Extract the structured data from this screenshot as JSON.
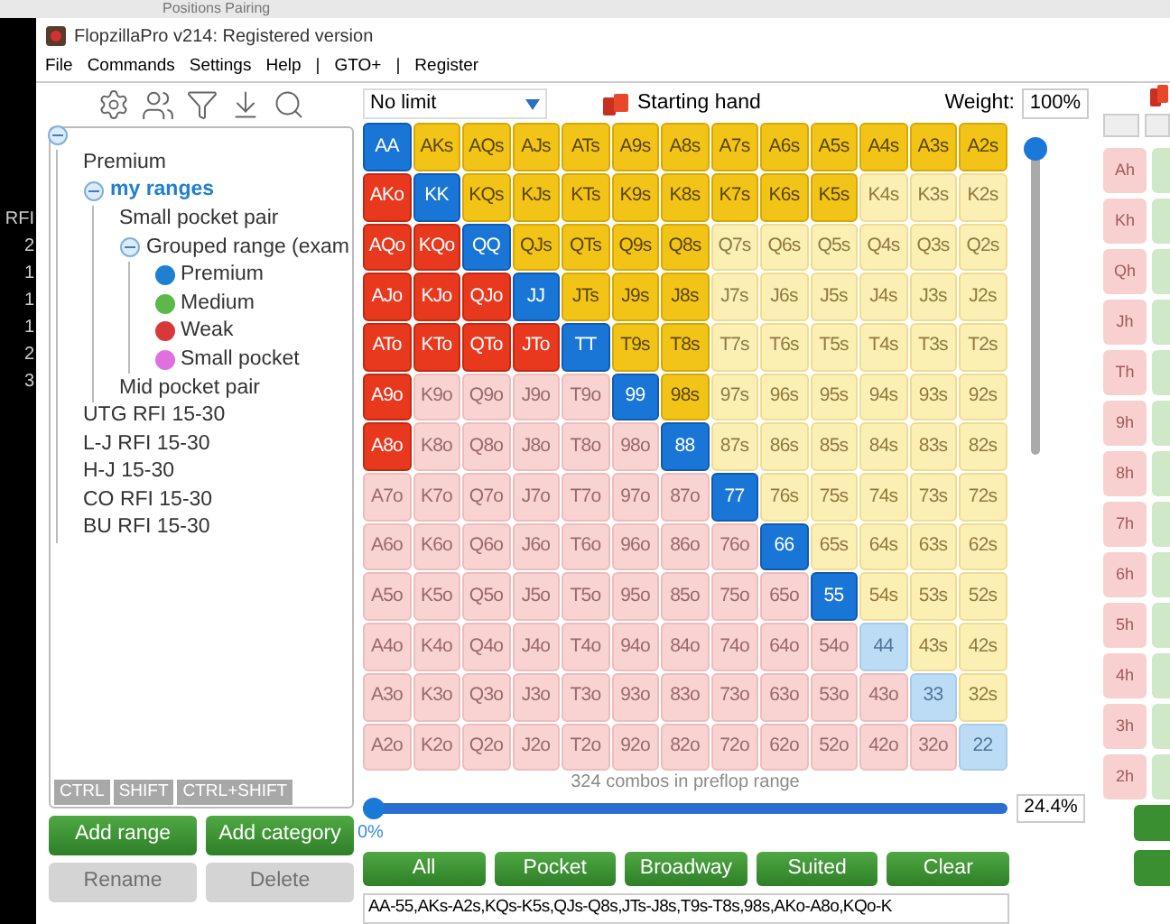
{
  "background_window": {
    "title": "Positions Pairing",
    "column_header": "RFI",
    "values": [
      "2",
      "1",
      "1",
      "1",
      "2",
      "3"
    ]
  },
  "window": {
    "title": "FlopzillaPro v214: Registered version"
  },
  "menu": [
    "File",
    "Commands",
    "Settings",
    "Help",
    "|",
    "GTO+",
    "|",
    "Register"
  ],
  "tree": {
    "expanded": true,
    "children": [
      {
        "label": "Premium",
        "selected": false
      },
      {
        "label": "my ranges",
        "selected": true,
        "expanded": true,
        "children": [
          {
            "label": "Small pocket pair",
            "selected": false
          },
          {
            "label": "Grouped range (exam",
            "selected": false,
            "expanded": true,
            "children": [
              {
                "label": "Premium",
                "selected": false,
                "color": "#1f7fd0"
              },
              {
                "label": "Medium",
                "selected": false,
                "color": "#5cb84a"
              },
              {
                "label": "Weak",
                "selected": false,
                "color": "#d8383a"
              },
              {
                "label": "Small pocket",
                "selected": false,
                "color": "#e070e0"
              }
            ]
          },
          {
            "label": "Mid pocket pair",
            "selected": false
          }
        ]
      },
      {
        "label": "UTG RFI 15-30",
        "selected": false
      },
      {
        "label": "L-J RFI 15-30",
        "selected": false
      },
      {
        "label": "H-J 15-30",
        "selected": false
      },
      {
        "label": "CO RFI 15-30",
        "selected": false
      },
      {
        "label": "BU RFI 15-30",
        "selected": false
      }
    ]
  },
  "modifier_keys": [
    "CTRL",
    "SHIFT",
    "CTRL+SHIFT"
  ],
  "left_buttons": [
    {
      "label": "Add range",
      "disabled": false
    },
    {
      "label": "Add category",
      "disabled": false
    },
    {
      "label": "Rename",
      "disabled": true
    },
    {
      "label": "Delete",
      "disabled": true
    }
  ],
  "game_select": {
    "value": "No limit"
  },
  "mode_label": "Starting hand",
  "weight": {
    "label": "Weight:",
    "value": "100%",
    "level": 1
  },
  "grid": [
    [
      {
        "label": "AA",
        "kind": "pair",
        "selected": true
      },
      {
        "label": "AKs",
        "kind": "suited",
        "selected": true
      },
      {
        "label": "AQs",
        "kind": "suited",
        "selected": true
      },
      {
        "label": "AJs",
        "kind": "suited",
        "selected": true
      },
      {
        "label": "ATs",
        "kind": "suited",
        "selected": true
      },
      {
        "label": "A9s",
        "kind": "suited",
        "selected": true
      },
      {
        "label": "A8s",
        "kind": "suited",
        "selected": true
      },
      {
        "label": "A7s",
        "kind": "suited",
        "selected": true
      },
      {
        "label": "A6s",
        "kind": "suited",
        "selected": true
      },
      {
        "label": "A5s",
        "kind": "suited",
        "selected": true
      },
      {
        "label": "A4s",
        "kind": "suited",
        "selected": true
      },
      {
        "label": "A3s",
        "kind": "suited",
        "selected": true
      },
      {
        "label": "A2s",
        "kind": "suited",
        "selected": true
      }
    ],
    [
      {
        "label": "AKo",
        "kind": "offsuit",
        "selected": true
      },
      {
        "label": "KK",
        "kind": "pair",
        "selected": true
      },
      {
        "label": "KQs",
        "kind": "suited",
        "selected": true
      },
      {
        "label": "KJs",
        "kind": "suited",
        "selected": true
      },
      {
        "label": "KTs",
        "kind": "suited",
        "selected": true
      },
      {
        "label": "K9s",
        "kind": "suited",
        "selected": true
      },
      {
        "label": "K8s",
        "kind": "suited",
        "selected": true
      },
      {
        "label": "K7s",
        "kind": "suited",
        "selected": true
      },
      {
        "label": "K6s",
        "kind": "suited",
        "selected": true
      },
      {
        "label": "K5s",
        "kind": "suited",
        "selected": true
      },
      {
        "label": "K4s",
        "kind": "suited",
        "selected": false
      },
      {
        "label": "K3s",
        "kind": "suited",
        "selected": false
      },
      {
        "label": "K2s",
        "kind": "suited",
        "selected": false
      }
    ],
    [
      {
        "label": "AQo",
        "kind": "offsuit",
        "selected": true
      },
      {
        "label": "KQo",
        "kind": "offsuit",
        "selected": true
      },
      {
        "label": "QQ",
        "kind": "pair",
        "selected": true
      },
      {
        "label": "QJs",
        "kind": "suited",
        "selected": true
      },
      {
        "label": "QTs",
        "kind": "suited",
        "selected": true
      },
      {
        "label": "Q9s",
        "kind": "suited",
        "selected": true
      },
      {
        "label": "Q8s",
        "kind": "suited",
        "selected": true
      },
      {
        "label": "Q7s",
        "kind": "suited",
        "selected": false
      },
      {
        "label": "Q6s",
        "kind": "suited",
        "selected": false
      },
      {
        "label": "Q5s",
        "kind": "suited",
        "selected": false
      },
      {
        "label": "Q4s",
        "kind": "suited",
        "selected": false
      },
      {
        "label": "Q3s",
        "kind": "suited",
        "selected": false
      },
      {
        "label": "Q2s",
        "kind": "suited",
        "selected": false
      }
    ],
    [
      {
        "label": "AJo",
        "kind": "offsuit",
        "selected": true
      },
      {
        "label": "KJo",
        "kind": "offsuit",
        "selected": true
      },
      {
        "label": "QJo",
        "kind": "offsuit",
        "selected": true
      },
      {
        "label": "JJ",
        "kind": "pair",
        "selected": true
      },
      {
        "label": "JTs",
        "kind": "suited",
        "selected": true
      },
      {
        "label": "J9s",
        "kind": "suited",
        "selected": true
      },
      {
        "label": "J8s",
        "kind": "suited",
        "selected": true
      },
      {
        "label": "J7s",
        "kind": "suited",
        "selected": false
      },
      {
        "label": "J6s",
        "kind": "suited",
        "selected": false
      },
      {
        "label": "J5s",
        "kind": "suited",
        "selected": false
      },
      {
        "label": "J4s",
        "kind": "suited",
        "selected": false
      },
      {
        "label": "J3s",
        "kind": "suited",
        "selected": false
      },
      {
        "label": "J2s",
        "kind": "suited",
        "selected": false
      }
    ],
    [
      {
        "label": "ATo",
        "kind": "offsuit",
        "selected": true
      },
      {
        "label": "KTo",
        "kind": "offsuit",
        "selected": true
      },
      {
        "label": "QTo",
        "kind": "offsuit",
        "selected": true
      },
      {
        "label": "JTo",
        "kind": "offsuit",
        "selected": true
      },
      {
        "label": "TT",
        "kind": "pair",
        "selected": true
      },
      {
        "label": "T9s",
        "kind": "suited",
        "selected": true
      },
      {
        "label": "T8s",
        "kind": "suited",
        "selected": true
      },
      {
        "label": "T7s",
        "kind": "suited",
        "selected": false
      },
      {
        "label": "T6s",
        "kind": "suited",
        "selected": false
      },
      {
        "label": "T5s",
        "kind": "suited",
        "selected": false
      },
      {
        "label": "T4s",
        "kind": "suited",
        "selected": false
      },
      {
        "label": "T3s",
        "kind": "suited",
        "selected": false
      },
      {
        "label": "T2s",
        "kind": "suited",
        "selected": false
      }
    ],
    [
      {
        "label": "A9o",
        "kind": "offsuit",
        "selected": true
      },
      {
        "label": "K9o",
        "kind": "offsuit",
        "selected": false
      },
      {
        "label": "Q9o",
        "kind": "offsuit",
        "selected": false
      },
      {
        "label": "J9o",
        "kind": "offsuit",
        "selected": false
      },
      {
        "label": "T9o",
        "kind": "offsuit",
        "selected": false
      },
      {
        "label": "99",
        "kind": "pair",
        "selected": true
      },
      {
        "label": "98s",
        "kind": "suited",
        "selected": true
      },
      {
        "label": "97s",
        "kind": "suited",
        "selected": false
      },
      {
        "label": "96s",
        "kind": "suited",
        "selected": false
      },
      {
        "label": "95s",
        "kind": "suited",
        "selected": false
      },
      {
        "label": "94s",
        "kind": "suited",
        "selected": false
      },
      {
        "label": "93s",
        "kind": "suited",
        "selected": false
      },
      {
        "label": "92s",
        "kind": "suited",
        "selected": false
      }
    ],
    [
      {
        "label": "A8o",
        "kind": "offsuit",
        "selected": true
      },
      {
        "label": "K8o",
        "kind": "offsuit",
        "selected": false
      },
      {
        "label": "Q8o",
        "kind": "offsuit",
        "selected": false
      },
      {
        "label": "J8o",
        "kind": "offsuit",
        "selected": false
      },
      {
        "label": "T8o",
        "kind": "offsuit",
        "selected": false
      },
      {
        "label": "98o",
        "kind": "offsuit",
        "selected": false
      },
      {
        "label": "88",
        "kind": "pair",
        "selected": true
      },
      {
        "label": "87s",
        "kind": "suited",
        "selected": false
      },
      {
        "label": "86s",
        "kind": "suited",
        "selected": false
      },
      {
        "label": "85s",
        "kind": "suited",
        "selected": false
      },
      {
        "label": "84s",
        "kind": "suited",
        "selected": false
      },
      {
        "label": "83s",
        "kind": "suited",
        "selected": false
      },
      {
        "label": "82s",
        "kind": "suited",
        "selected": false
      }
    ],
    [
      {
        "label": "A7o",
        "kind": "offsuit",
        "selected": false
      },
      {
        "label": "K7o",
        "kind": "offsuit",
        "selected": false
      },
      {
        "label": "Q7o",
        "kind": "offsuit",
        "selected": false
      },
      {
        "label": "J7o",
        "kind": "offsuit",
        "selected": false
      },
      {
        "label": "T7o",
        "kind": "offsuit",
        "selected": false
      },
      {
        "label": "97o",
        "kind": "offsuit",
        "selected": false
      },
      {
        "label": "87o",
        "kind": "offsuit",
        "selected": false
      },
      {
        "label": "77",
        "kind": "pair",
        "selected": true
      },
      {
        "label": "76s",
        "kind": "suited",
        "selected": false
      },
      {
        "label": "75s",
        "kind": "suited",
        "selected": false
      },
      {
        "label": "74s",
        "kind": "suited",
        "selected": false
      },
      {
        "label": "73s",
        "kind": "suited",
        "selected": false
      },
      {
        "label": "72s",
        "kind": "suited",
        "selected": false
      }
    ],
    [
      {
        "label": "A6o",
        "kind": "offsuit",
        "selected": false
      },
      {
        "label": "K6o",
        "kind": "offsuit",
        "selected": false
      },
      {
        "label": "Q6o",
        "kind": "offsuit",
        "selected": false
      },
      {
        "label": "J6o",
        "kind": "offsuit",
        "selected": false
      },
      {
        "label": "T6o",
        "kind": "offsuit",
        "selected": false
      },
      {
        "label": "96o",
        "kind": "offsuit",
        "selected": false
      },
      {
        "label": "86o",
        "kind": "offsuit",
        "selected": false
      },
      {
        "label": "76o",
        "kind": "offsuit",
        "selected": false
      },
      {
        "label": "66",
        "kind": "pair",
        "selected": true
      },
      {
        "label": "65s",
        "kind": "suited",
        "selected": false
      },
      {
        "label": "64s",
        "kind": "suited",
        "selected": false
      },
      {
        "label": "63s",
        "kind": "suited",
        "selected": false
      },
      {
        "label": "62s",
        "kind": "suited",
        "selected": false
      }
    ],
    [
      {
        "label": "A5o",
        "kind": "offsuit",
        "selected": false
      },
      {
        "label": "K5o",
        "kind": "offsuit",
        "selected": false
      },
      {
        "label": "Q5o",
        "kind": "offsuit",
        "selected": false
      },
      {
        "label": "J5o",
        "kind": "offsuit",
        "selected": false
      },
      {
        "label": "T5o",
        "kind": "offsuit",
        "selected": false
      },
      {
        "label": "95o",
        "kind": "offsuit",
        "selected": false
      },
      {
        "label": "85o",
        "kind": "offsuit",
        "selected": false
      },
      {
        "label": "75o",
        "kind": "offsuit",
        "selected": false
      },
      {
        "label": "65o",
        "kind": "offsuit",
        "selected": false
      },
      {
        "label": "55",
        "kind": "pair",
        "selected": true
      },
      {
        "label": "54s",
        "kind": "suited",
        "selected": false
      },
      {
        "label": "53s",
        "kind": "suited",
        "selected": false
      },
      {
        "label": "52s",
        "kind": "suited",
        "selected": false
      }
    ],
    [
      {
        "label": "A4o",
        "kind": "offsuit",
        "selected": false
      },
      {
        "label": "K4o",
        "kind": "offsuit",
        "selected": false
      },
      {
        "label": "Q4o",
        "kind": "offsuit",
        "selected": false
      },
      {
        "label": "J4o",
        "kind": "offsuit",
        "selected": false
      },
      {
        "label": "T4o",
        "kind": "offsuit",
        "selected": false
      },
      {
        "label": "94o",
        "kind": "offsuit",
        "selected": false
      },
      {
        "label": "84o",
        "kind": "offsuit",
        "selected": false
      },
      {
        "label": "74o",
        "kind": "offsuit",
        "selected": false
      },
      {
        "label": "64o",
        "kind": "offsuit",
        "selected": false
      },
      {
        "label": "54o",
        "kind": "offsuit",
        "selected": false
      },
      {
        "label": "44",
        "kind": "pair",
        "selected": false
      },
      {
        "label": "43s",
        "kind": "suited",
        "selected": false
      },
      {
        "label": "42s",
        "kind": "suited",
        "selected": false
      }
    ],
    [
      {
        "label": "A3o",
        "kind": "offsuit",
        "selected": false
      },
      {
        "label": "K3o",
        "kind": "offsuit",
        "selected": false
      },
      {
        "label": "Q3o",
        "kind": "offsuit",
        "selected": false
      },
      {
        "label": "J3o",
        "kind": "offsuit",
        "selected": false
      },
      {
        "label": "T3o",
        "kind": "offsuit",
        "selected": false
      },
      {
        "label": "93o",
        "kind": "offsuit",
        "selected": false
      },
      {
        "label": "83o",
        "kind": "offsuit",
        "selected": false
      },
      {
        "label": "73o",
        "kind": "offsuit",
        "selected": false
      },
      {
        "label": "63o",
        "kind": "offsuit",
        "selected": false
      },
      {
        "label": "53o",
        "kind": "offsuit",
        "selected": false
      },
      {
        "label": "43o",
        "kind": "offsuit",
        "selected": false
      },
      {
        "label": "33",
        "kind": "pair",
        "selected": false
      },
      {
        "label": "32s",
        "kind": "suited",
        "selected": false
      }
    ],
    [
      {
        "label": "A2o",
        "kind": "offsuit",
        "selected": false
      },
      {
        "label": "K2o",
        "kind": "offsuit",
        "selected": false
      },
      {
        "label": "Q2o",
        "kind": "offsuit",
        "selected": false
      },
      {
        "label": "J2o",
        "kind": "offsuit",
        "selected": false
      },
      {
        "label": "T2o",
        "kind": "offsuit",
        "selected": false
      },
      {
        "label": "92o",
        "kind": "offsuit",
        "selected": false
      },
      {
        "label": "82o",
        "kind": "offsuit",
        "selected": false
      },
      {
        "label": "72o",
        "kind": "offsuit",
        "selected": false
      },
      {
        "label": "62o",
        "kind": "offsuit",
        "selected": false
      },
      {
        "label": "52o",
        "kind": "offsuit",
        "selected": false
      },
      {
        "label": "42o",
        "kind": "offsuit",
        "selected": false
      },
      {
        "label": "32o",
        "kind": "offsuit",
        "selected": false
      },
      {
        "label": "22",
        "kind": "pair",
        "selected": false
      }
    ]
  ],
  "combos_text": "324 combos in preflop range",
  "percent_slider": {
    "level": 0,
    "min_label": "0%",
    "value": "24.4%"
  },
  "preset_buttons": [
    "All",
    "Pocket",
    "Broadway",
    "Suited",
    "Clear"
  ],
  "range_text": "AA-55,AKs-A2s,KQs-K5s,QJs-Q8s,JTs-J8s,T9s-T8s,98s,AKo-A8o,KQo-K",
  "card_buttons": [
    "Ah",
    "Kh",
    "Qh",
    "Jh",
    "Th",
    "9h",
    "8h",
    "7h",
    "6h",
    "5h",
    "4h",
    "3h",
    "2h"
  ]
}
